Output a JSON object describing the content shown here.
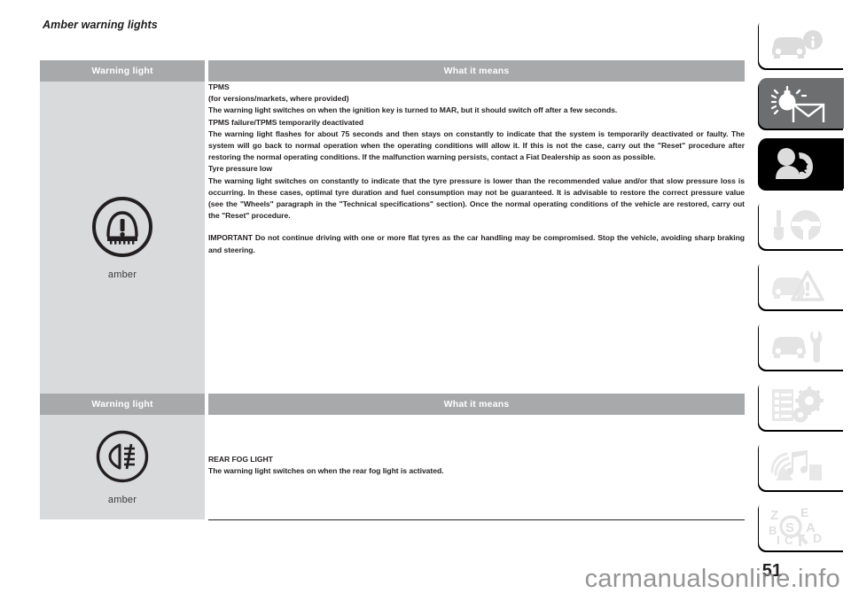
{
  "page": {
    "title": "Amber warning lights",
    "number": "51",
    "watermark": "carmanualsonline.info"
  },
  "tables": [
    {
      "id": "tpms",
      "headers": {
        "light": "Warning light",
        "means": "What it means"
      },
      "icon": {
        "name": "tpms-warning-icon",
        "color_label": "amber"
      },
      "content": {
        "title": "TPMS",
        "subtitle": "(for versions/markets, where provided)",
        "intro": "The warning light switches on when the ignition key is turned to MAR, but it should switch off after a few seconds.",
        "section1_title": "TPMS failure/TPMS temporarily deactivated",
        "section1_body": "The warning light flashes for about 75 seconds and then stays on constantly to indicate that the system is temporarily deactivated or faulty. The system will go back to normal operation when the operating conditions will allow it. If this is not the case, carry out the \"Reset\" procedure after restoring the normal operating conditions. If the malfunction warning persists, contact a Fiat Dealership as soon as possible.",
        "section2_title": "Tyre pressure low",
        "section2_body": "The warning light switches on constantly to indicate that the tyre pressure is lower than the recommended value and/or that slow pressure loss is occurring. In these cases, optimal tyre duration and fuel consumption may not be guaranteed. It is advisable to restore the correct pressure value (see the \"Wheels\" paragraph in the \"Technical specifications\" section). Once the normal operating conditions of the vehicle are restored, carry out the \"Reset\" procedure.",
        "important": "IMPORTANT Do not continue driving with one or more flat tyres as the car handling may be compromised. Stop the vehicle, avoiding sharp braking and steering."
      }
    },
    {
      "id": "fog",
      "headers": {
        "light": "Warning light",
        "means": "What it means"
      },
      "icon": {
        "name": "rear-fog-light-icon",
        "color_label": "amber"
      },
      "content": {
        "title": "REAR FOG LIGHT",
        "body": "The warning light switches on when the rear fog light is activated."
      }
    }
  ],
  "tab_strip": {
    "tabs": [
      {
        "name": "tab-dashboard-and-controls",
        "icon": "car-info-icon",
        "style": "light"
      },
      {
        "name": "tab-warning-lights-messages",
        "icon": "bulb-envelope-icon",
        "style": "mid"
      },
      {
        "name": "tab-safety",
        "icon": "airbag-seat-icon",
        "style": "dark"
      },
      {
        "name": "tab-starting-and-driving",
        "icon": "key-steering-icon",
        "style": "light"
      },
      {
        "name": "tab-in-an-emergency",
        "icon": "car-hazard-icon",
        "style": "light"
      },
      {
        "name": "tab-maintenance-and-care",
        "icon": "car-wrench-icon",
        "style": "light"
      },
      {
        "name": "tab-technical-specifications",
        "icon": "list-gears-icon",
        "style": "light"
      },
      {
        "name": "tab-multimedia",
        "icon": "media-signal-icon",
        "style": "light"
      },
      {
        "name": "tab-alphabetical-index",
        "icon": "index-search-icon",
        "style": "light"
      }
    ]
  },
  "colors": {
    "header_bar": "#a7a9ab",
    "icon_cell_bg": "#d9dadb",
    "text": "#231f20",
    "tab_mid": "#6d6e70",
    "tab_dark": "#000000"
  }
}
